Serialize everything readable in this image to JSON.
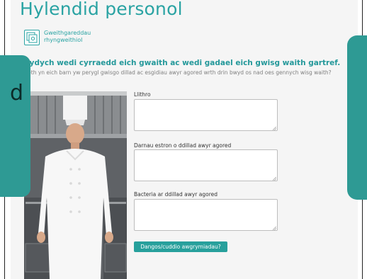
{
  "page": {
    "title": "Hylendid personol",
    "collaboration": {
      "icon": "group-work-icon",
      "label": "Gweithgareddau rhyngweithiol"
    },
    "heading": "Rydych wedi cyrraedd eich gwaith ac wedi gadael eich gwisg waith gartref.",
    "instructions": "Beth yn eich barn yw perygl gwisgo dillad ac esgidiau awyr agored wrth drin bwyd os nad oes gennych wisg waith?"
  },
  "form": {
    "fields": [
      {
        "label": "Llithro",
        "value": ""
      },
      {
        "label": "Darnau estron o ddillad awyr agored",
        "value": ""
      },
      {
        "label": "Bacteria ar ddillad awyr agored",
        "value": ""
      }
    ],
    "toggle_button": "Dangos/cuddio awgrymiadau?"
  },
  "nav": {
    "prev_partial_text": "d"
  },
  "colors": {
    "accent": "#2aa3a3",
    "nav_panel": "#2e9a94",
    "button": "#27a09c",
    "page_bg": "#f5f5f5"
  }
}
